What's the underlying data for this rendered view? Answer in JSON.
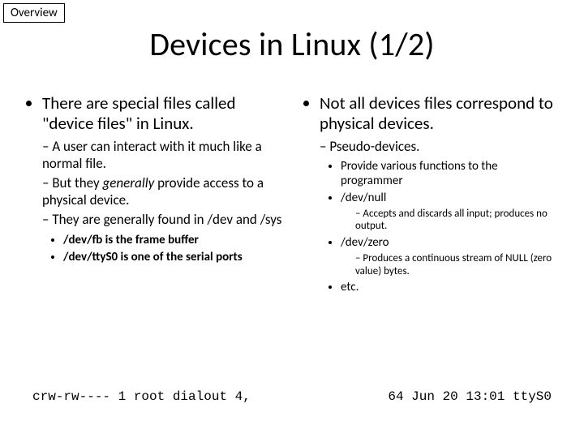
{
  "tag": "Overview",
  "title": "Devices in Linux (1/2)",
  "left": {
    "point": "There are special files called \"device files\" in Linux.",
    "subs": [
      "A user can interact with it much like a normal file.",
      "But they generally provide access to a physical device.",
      "They are generally found in /dev and /sys"
    ],
    "examples": [
      "/dev/fb is the frame buffer",
      "/dev/ttyS0 is one of the serial ports"
    ]
  },
  "right": {
    "point": "Not all devices files correspond to physical devices.",
    "sub": "Pseudo-devices.",
    "pseudo": [
      {
        "head": "Provide various functions to the programmer",
        "children": []
      },
      {
        "head": "/dev/null",
        "children": [
          "Accepts and discards all input; produces no output."
        ]
      },
      {
        "head": "/dev/zero",
        "children": [
          "Produces a continuous stream of NULL (zero value) bytes."
        ]
      },
      {
        "head": "etc.",
        "children": []
      }
    ]
  },
  "ls": {
    "left": "crw-rw---- 1 root dialout   4,",
    "right": "64 Jun 20 13:01 ttyS0"
  }
}
